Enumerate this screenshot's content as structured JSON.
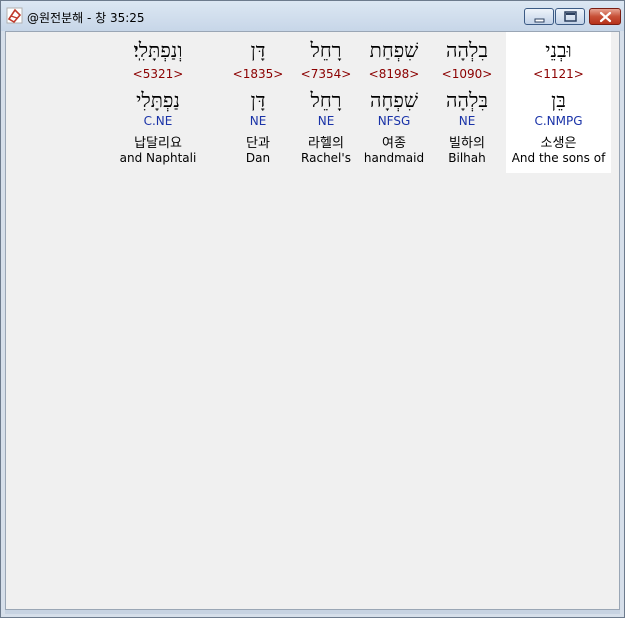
{
  "window": {
    "title": "@원전분해 - 창 35:25"
  },
  "colors": {
    "strong_number": "#8b0000",
    "morphology": "#1a33a8",
    "highlight_background": "#ffffff"
  },
  "words": [
    {
      "hebrew": "וּבְנֵי",
      "strong": "<1121>",
      "lemma": "בֵּן",
      "morph": "C.NMPG",
      "korean": "소생은",
      "english": "And the sons of",
      "highlighted": true
    },
    {
      "hebrew": "בִלְהָה",
      "strong": "<1090>",
      "lemma": "בִּלְהָה",
      "morph": "NE",
      "korean": "빌하의",
      "english": "Bilhah",
      "highlighted": false
    },
    {
      "hebrew": "שִׁפְחַת",
      "strong": "<8198>",
      "lemma": "שִׁפְחָה",
      "morph": "NFSG",
      "korean": "여종",
      "english": "handmaid",
      "highlighted": false
    },
    {
      "hebrew": "רָחֵל",
      "strong": "<7354>",
      "lemma": "רָחֵל",
      "morph": "NE",
      "korean": "라헬의",
      "english": "Rachel's",
      "highlighted": false
    },
    {
      "hebrew": "דָּן",
      "strong": "<1835>",
      "lemma": "דָּן",
      "morph": "NE",
      "korean": "단과",
      "english": "Dan",
      "highlighted": false
    },
    {
      "hebrew": "וְנַפְתָּלִֽי׃",
      "strong": "<5321>",
      "lemma": "נַפְתָּלִי",
      "morph": "C.NE",
      "korean": "납달리요",
      "english": "and Naphtali",
      "highlighted": false
    }
  ]
}
